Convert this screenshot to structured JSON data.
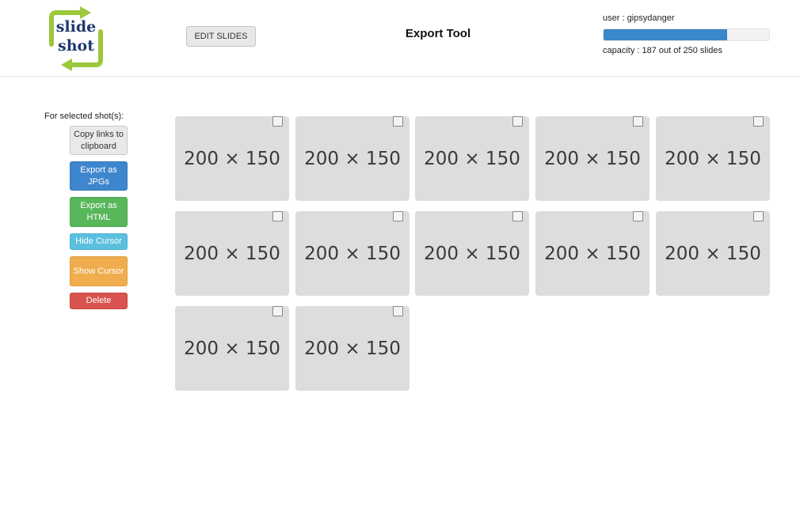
{
  "header": {
    "logo_line1": "slide",
    "logo_line2": "shot",
    "edit_button": "EDIT SLIDES",
    "title": "Export Tool",
    "user_label": "user : gipsydanger",
    "capacity_label": "capacity : 187 out of 250 slides",
    "capacity_used": 187,
    "capacity_total": 250
  },
  "sidebar": {
    "heading": "For selected shot(s):",
    "buttons": {
      "copy": "Copy links to clipboard",
      "jpg": "Export as JPGs",
      "html": "Export as HTML",
      "hide_cursor": "Hide Cursor",
      "show_cursor": "Show Cursor",
      "delete": "Delete"
    }
  },
  "thumbnails": [
    {
      "label": "200 × 150",
      "checked": false
    },
    {
      "label": "200 × 150",
      "checked": false
    },
    {
      "label": "200 × 150",
      "checked": false
    },
    {
      "label": "200 × 150",
      "checked": false
    },
    {
      "label": "200 × 150",
      "checked": false
    },
    {
      "label": "200 × 150",
      "checked": false
    },
    {
      "label": "200 × 150",
      "checked": false
    },
    {
      "label": "200 × 150",
      "checked": false
    },
    {
      "label": "200 × 150",
      "checked": false
    },
    {
      "label": "200 × 150",
      "checked": false
    },
    {
      "label": "200 × 150",
      "checked": false
    },
    {
      "label": "200 × 150",
      "checked": false
    }
  ],
  "colors": {
    "capacity_fill": "#3a87cc",
    "logo_arrow": "#9cc83c",
    "logo_text": "#1f3a6e",
    "btn_primary": "#3e86cd",
    "btn_success": "#58b75b",
    "btn_info": "#5bc0de",
    "btn_warning": "#f0ad4e",
    "btn_danger": "#d9534f"
  }
}
